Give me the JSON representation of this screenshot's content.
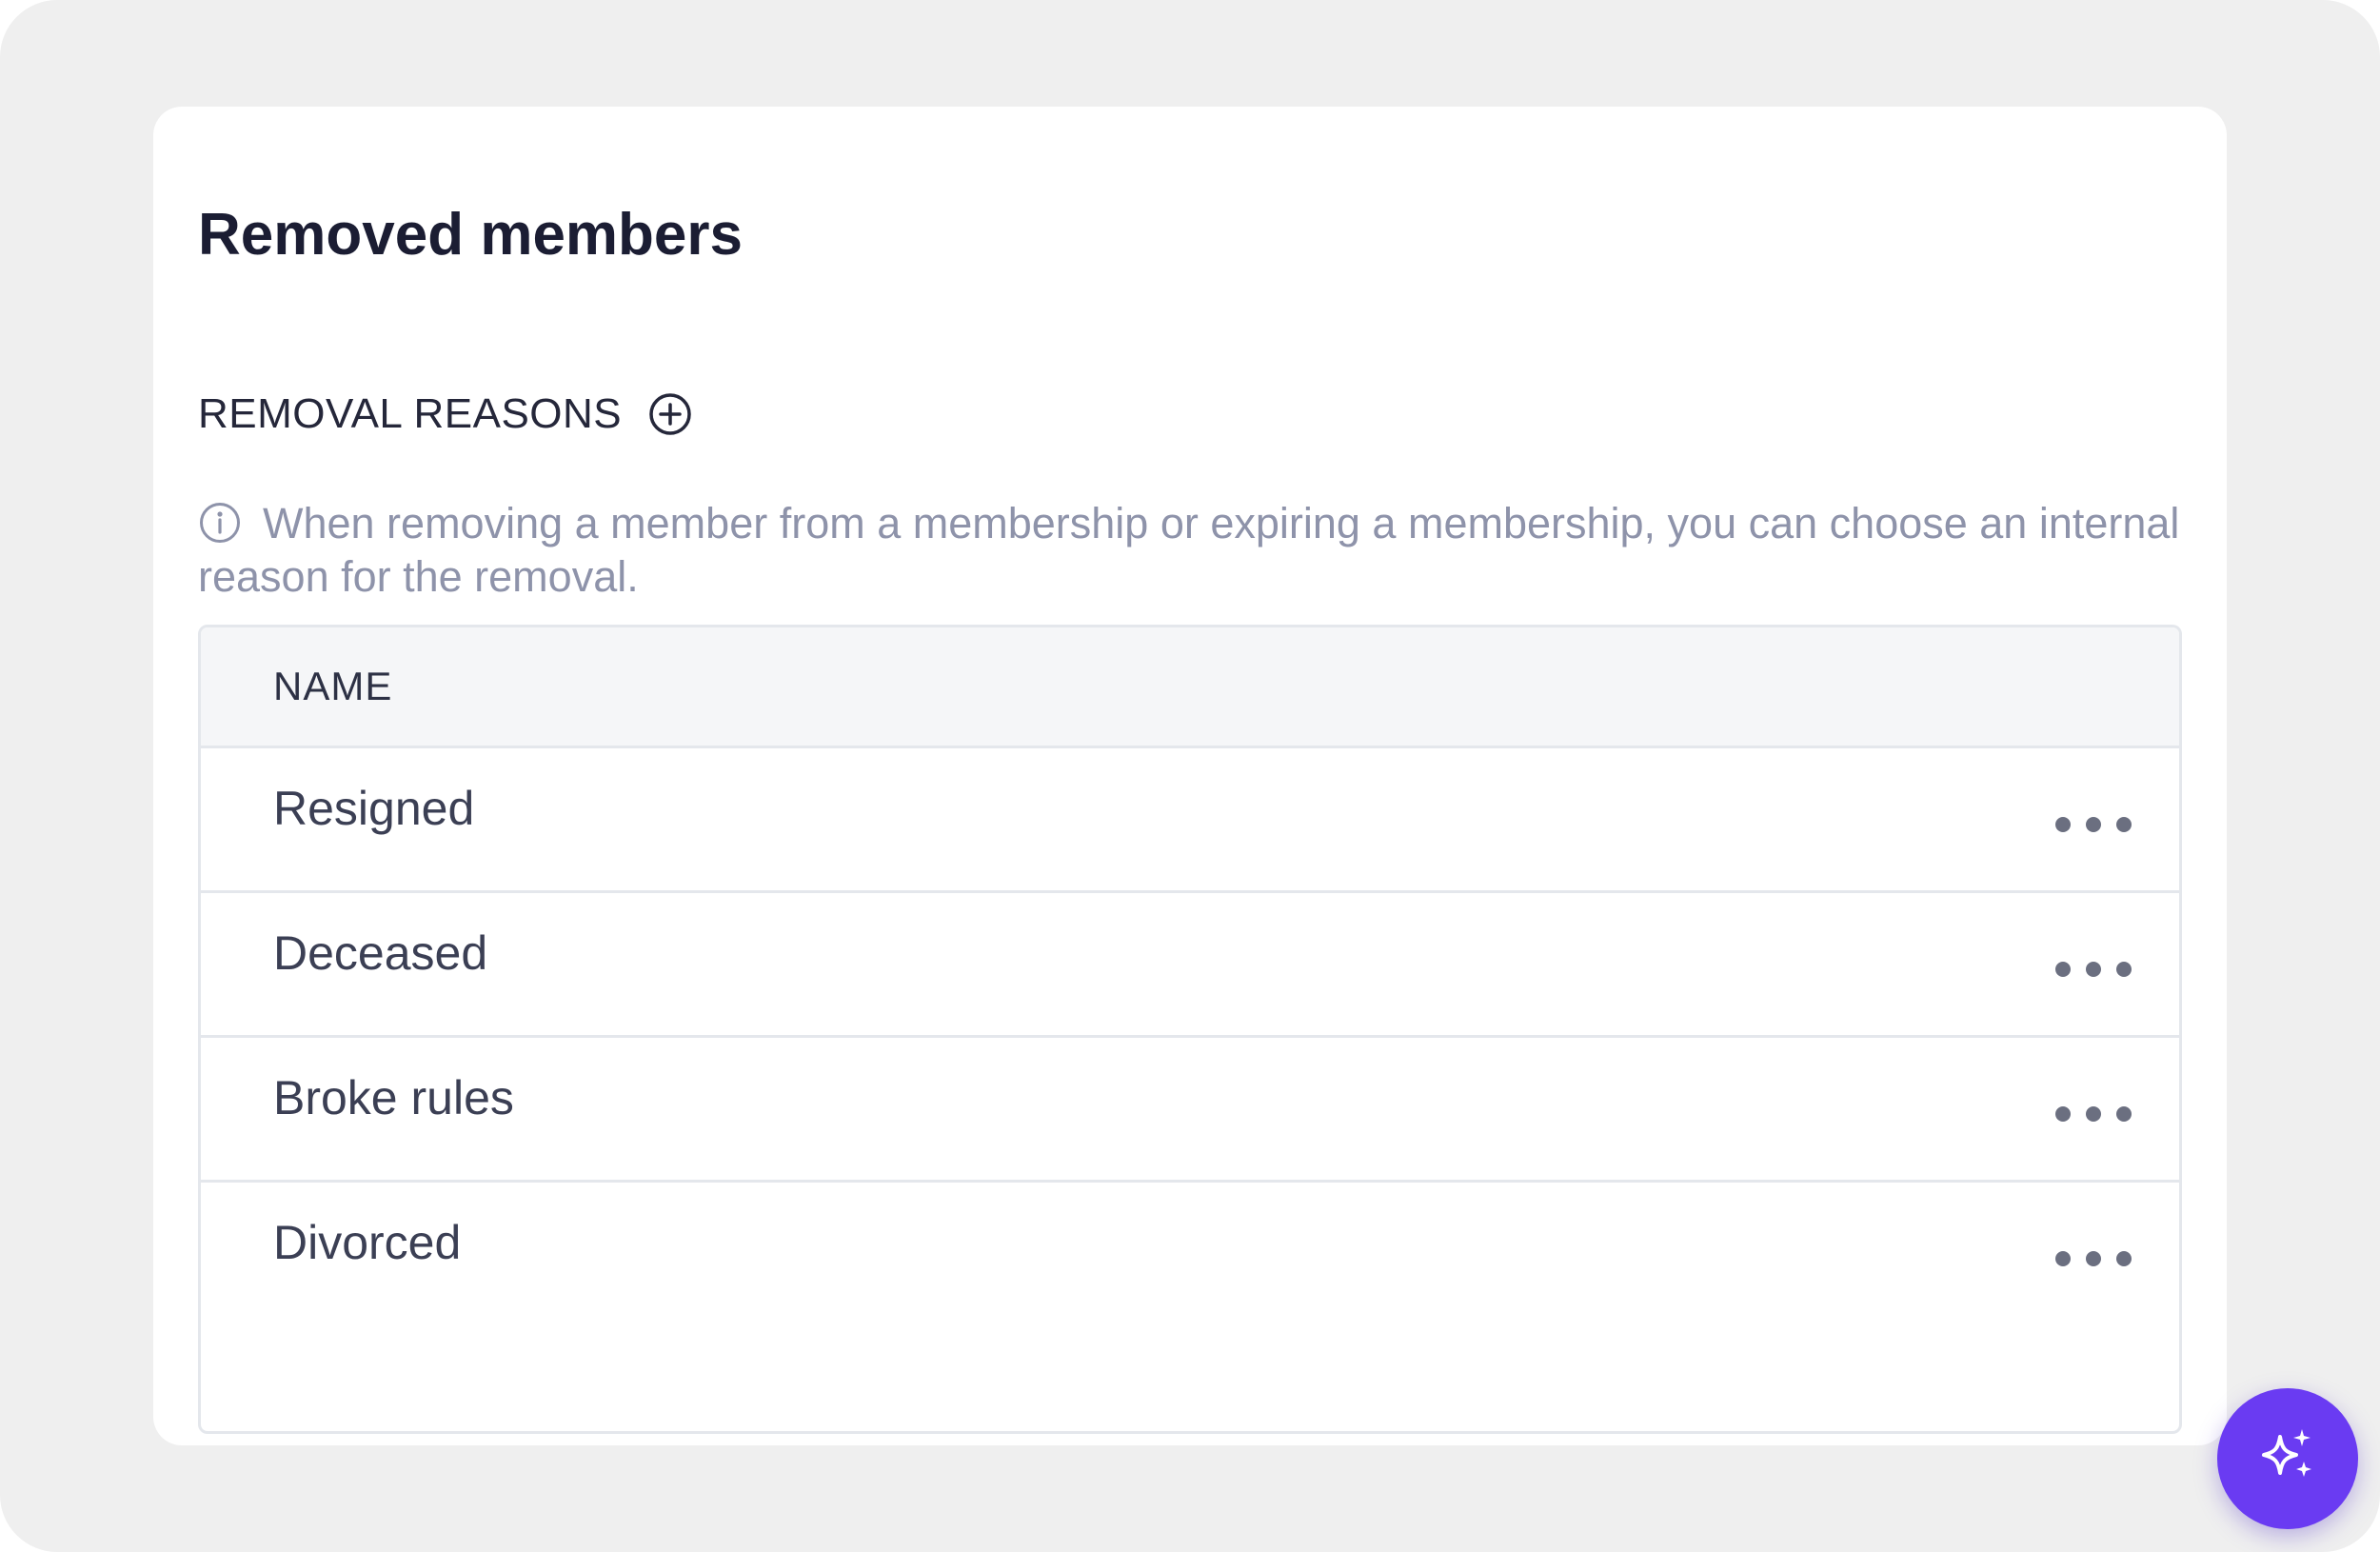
{
  "page": {
    "title": "Removed members"
  },
  "section": {
    "label": "REMOVAL REASONS",
    "add_icon": "plus-circle-icon",
    "info_icon": "info-circle-icon",
    "info_text": "When removing a member from a membership or expiring a membership, you can choose an internal reason for the removal."
  },
  "table": {
    "columns": [
      "NAME"
    ],
    "rows": [
      {
        "name": "Resigned"
      },
      {
        "name": "Deceased"
      },
      {
        "name": "Broke rules"
      },
      {
        "name": "Divorced"
      }
    ],
    "row_action_icon": "more-horizontal-icon"
  },
  "fab": {
    "icon": "sparkles-icon"
  },
  "colors": {
    "background": "#efefef",
    "card": "#ffffff",
    "title": "#1b1d33",
    "muted_text": "#8e93aa",
    "header_bg": "#f5f6f8",
    "border": "#e4e7ec",
    "accent": "#6a3bf2"
  }
}
